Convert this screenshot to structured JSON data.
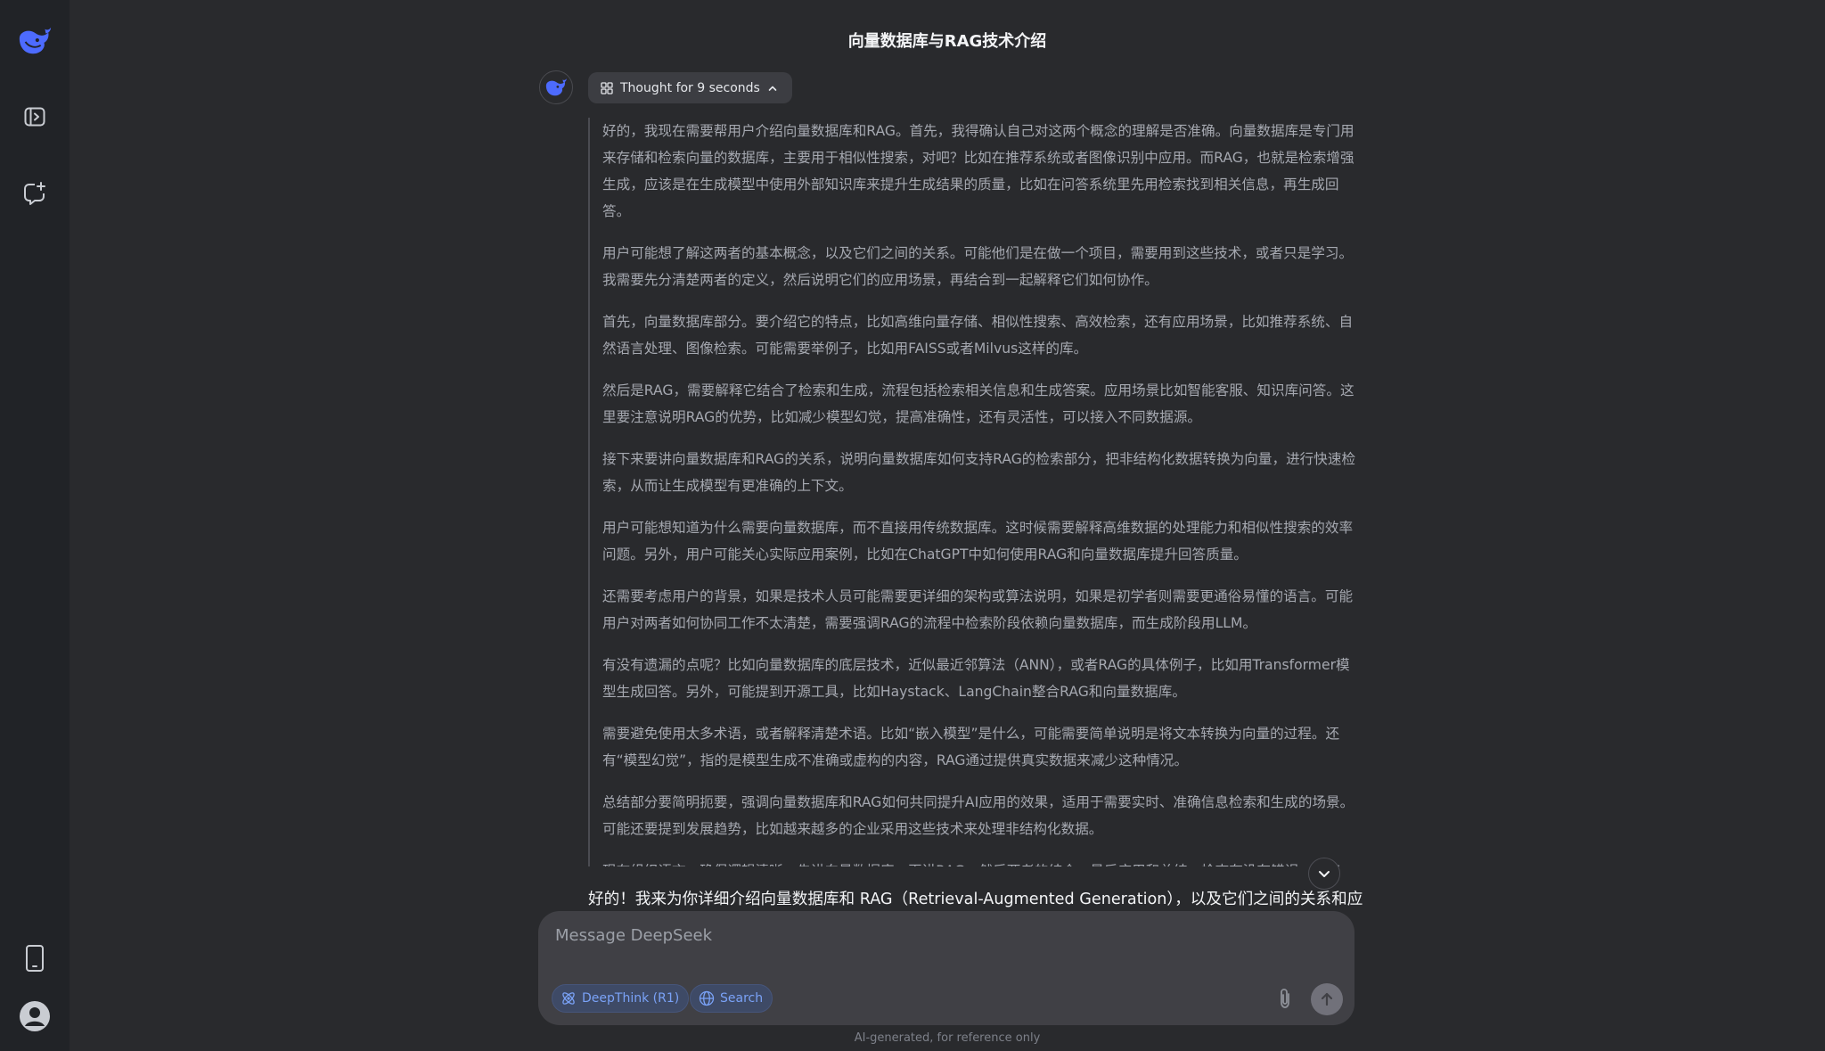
{
  "sidebar": {
    "logo_icon": "deepseek-whale-icon",
    "toggle_icon": "sidebar-toggle-icon",
    "new_chat_icon": "new-chat-icon",
    "mobile_app_icon": "mobile-phone-icon",
    "profile_icon": "user-avatar-icon"
  },
  "conversation": {
    "title": "向量数据库与RAG技术介绍",
    "thought_label": "Thought for 9 seconds",
    "thinking_paragraphs": [
      "好的，我现在需要帮用户介绍向量数据库和RAG。首先，我得确认自己对这两个概念的理解是否准确。向量数据库是专门用来存储和检索向量的数据库，主要用于相似性搜索，对吧？比如在推荐系统或者图像识别中应用。而RAG，也就是检索增强生成，应该是在生成模型中使用外部知识库来提升生成结果的质量，比如在问答系统里先用检索找到相关信息，再生成回答。",
      "用户可能想了解这两者的基本概念，以及它们之间的关系。可能他们是在做一个项目，需要用到这些技术，或者只是学习。我需要先分清楚两者的定义，然后说明它们的应用场景，再结合到一起解释它们如何协作。",
      "首先，向量数据库部分。要介绍它的特点，比如高维向量存储、相似性搜索、高效检索，还有应用场景，比如推荐系统、自然语言处理、图像检索。可能需要举例子，比如用FAISS或者Milvus这样的库。",
      "然后是RAG，需要解释它结合了检索和生成，流程包括检索相关信息和生成答案。应用场景比如智能客服、知识库问答。这里要注意说明RAG的优势，比如减少模型幻觉，提高准确性，还有灵活性，可以接入不同数据源。",
      "接下来要讲向量数据库和RAG的关系，说明向量数据库如何支持RAG的检索部分，把非结构化数据转换为向量，进行快速检索，从而让生成模型有更准确的上下文。",
      "用户可能想知道为什么需要向量数据库，而不直接用传统数据库。这时候需要解释高维数据的处理能力和相似性搜索的效率问题。另外，用户可能关心实际应用案例，比如在ChatGPT中如何使用RAG和向量数据库提升回答质量。",
      "还需要考虑用户的背景，如果是技术人员可能需要更详细的架构或算法说明，如果是初学者则需要更通俗易懂的语言。可能用户对两者如何协同工作不太清楚，需要强调RAG的流程中检索阶段依赖向量数据库，而生成阶段用LLM。",
      "有没有遗漏的点呢？比如向量数据库的底层技术，近似最近邻算法（ANN），或者RAG的具体例子，比如用Transformer模型生成回答。另外，可能提到开源工具，比如Haystack、LangChain整合RAG和向量数据库。",
      "需要避免使用太多术语，或者解释清楚术语。比如“嵌入模型”是什么，可能需要简单说明是将文本转换为向量的过程。还有“模型幻觉”，指的是模型生成不准确或虚构的内容，RAG通过提供真实数据来减少这种情况。",
      "总结部分要简明扼要，强调向量数据库和RAG如何共同提升AI应用的效果，适用于需要实时、准确信息检索和生成的场景。可能还要提到发展趋势，比如越来越多的企业采用这些技术来处理非结构化数据。",
      "现在组织语言，确保逻辑清晰，先讲向量数据库，再讲RAG，然后两者的结合，最后应用和总结。检查有没有错误，比如RAG是否只能用于问答，或者向量数据库的其他应用。确保每个部分都有例子，帮助用户理解。"
    ],
    "answer_preview": "好的！我来为你详细介绍向量数据库和 RAG（Retrieval-Augmented Generation），以及它们之间的关系和应"
  },
  "composer": {
    "placeholder": "Message DeepSeek",
    "deepthink_label": "DeepThink (R1)",
    "search_label": "Search",
    "disclaimer": "AI-generated, for reference only"
  },
  "colors": {
    "accent": "#4d6bfe",
    "pill_text": "#7aa2f7",
    "background": "#292a2d",
    "sidebar": "#212327"
  }
}
